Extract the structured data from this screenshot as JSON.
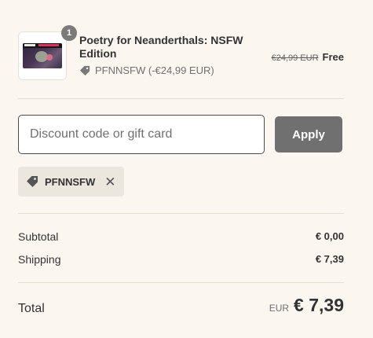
{
  "product": {
    "quantity": "1",
    "title": "Poetry for Neanderthals: NSFW Edition",
    "discount_line": "PFNNSFW (-€24,99 EUR)",
    "price_original": "€24,99 EUR",
    "price_final": "Free",
    "thumbnail_icon": "book-cover-image"
  },
  "discount": {
    "placeholder": "Discount code or gift card",
    "value": "",
    "apply_label": "Apply"
  },
  "applied_code": {
    "code": "PFNNSFW",
    "icon": "tag-icon",
    "remove_icon": "close-icon"
  },
  "summary": {
    "subtotal_label": "Subtotal",
    "subtotal_value": "€ 0,00",
    "shipping_label": "Shipping",
    "shipping_value": "€ 7,39",
    "total_label": "Total",
    "total_currency": "EUR",
    "total_value": "€ 7,39"
  },
  "colors": {
    "background": "#fbf7f0",
    "button": "#707070",
    "text": "#333333",
    "badge": "#7a7a7a"
  }
}
